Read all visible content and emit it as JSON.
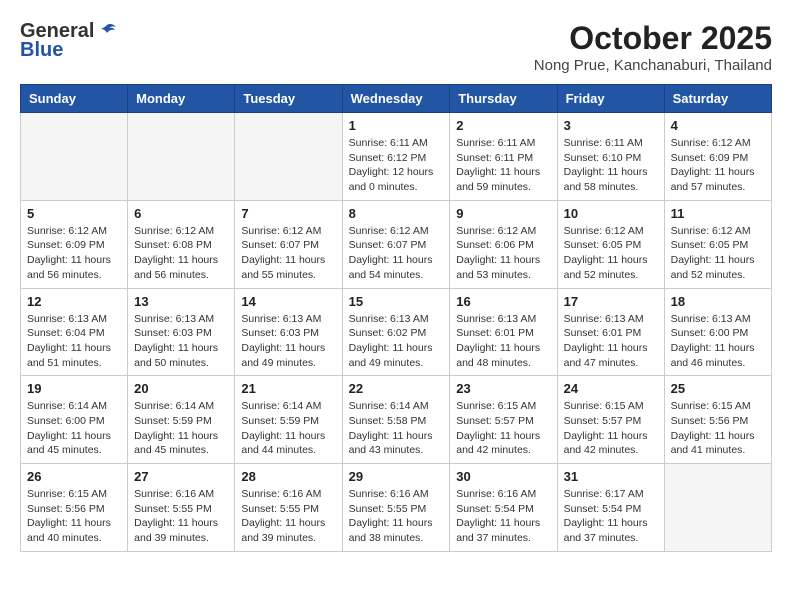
{
  "header": {
    "logo_general": "General",
    "logo_blue": "Blue",
    "month_title": "October 2025",
    "location": "Nong Prue, Kanchanaburi, Thailand"
  },
  "weekdays": [
    "Sunday",
    "Monday",
    "Tuesday",
    "Wednesday",
    "Thursday",
    "Friday",
    "Saturday"
  ],
  "weeks": [
    [
      {
        "day": "",
        "info": ""
      },
      {
        "day": "",
        "info": ""
      },
      {
        "day": "",
        "info": ""
      },
      {
        "day": "1",
        "info": "Sunrise: 6:11 AM\nSunset: 6:12 PM\nDaylight: 12 hours\nand 0 minutes."
      },
      {
        "day": "2",
        "info": "Sunrise: 6:11 AM\nSunset: 6:11 PM\nDaylight: 11 hours\nand 59 minutes."
      },
      {
        "day": "3",
        "info": "Sunrise: 6:11 AM\nSunset: 6:10 PM\nDaylight: 11 hours\nand 58 minutes."
      },
      {
        "day": "4",
        "info": "Sunrise: 6:12 AM\nSunset: 6:09 PM\nDaylight: 11 hours\nand 57 minutes."
      }
    ],
    [
      {
        "day": "5",
        "info": "Sunrise: 6:12 AM\nSunset: 6:09 PM\nDaylight: 11 hours\nand 56 minutes."
      },
      {
        "day": "6",
        "info": "Sunrise: 6:12 AM\nSunset: 6:08 PM\nDaylight: 11 hours\nand 56 minutes."
      },
      {
        "day": "7",
        "info": "Sunrise: 6:12 AM\nSunset: 6:07 PM\nDaylight: 11 hours\nand 55 minutes."
      },
      {
        "day": "8",
        "info": "Sunrise: 6:12 AM\nSunset: 6:07 PM\nDaylight: 11 hours\nand 54 minutes."
      },
      {
        "day": "9",
        "info": "Sunrise: 6:12 AM\nSunset: 6:06 PM\nDaylight: 11 hours\nand 53 minutes."
      },
      {
        "day": "10",
        "info": "Sunrise: 6:12 AM\nSunset: 6:05 PM\nDaylight: 11 hours\nand 52 minutes."
      },
      {
        "day": "11",
        "info": "Sunrise: 6:12 AM\nSunset: 6:05 PM\nDaylight: 11 hours\nand 52 minutes."
      }
    ],
    [
      {
        "day": "12",
        "info": "Sunrise: 6:13 AM\nSunset: 6:04 PM\nDaylight: 11 hours\nand 51 minutes."
      },
      {
        "day": "13",
        "info": "Sunrise: 6:13 AM\nSunset: 6:03 PM\nDaylight: 11 hours\nand 50 minutes."
      },
      {
        "day": "14",
        "info": "Sunrise: 6:13 AM\nSunset: 6:03 PM\nDaylight: 11 hours\nand 49 minutes."
      },
      {
        "day": "15",
        "info": "Sunrise: 6:13 AM\nSunset: 6:02 PM\nDaylight: 11 hours\nand 49 minutes."
      },
      {
        "day": "16",
        "info": "Sunrise: 6:13 AM\nSunset: 6:01 PM\nDaylight: 11 hours\nand 48 minutes."
      },
      {
        "day": "17",
        "info": "Sunrise: 6:13 AM\nSunset: 6:01 PM\nDaylight: 11 hours\nand 47 minutes."
      },
      {
        "day": "18",
        "info": "Sunrise: 6:13 AM\nSunset: 6:00 PM\nDaylight: 11 hours\nand 46 minutes."
      }
    ],
    [
      {
        "day": "19",
        "info": "Sunrise: 6:14 AM\nSunset: 6:00 PM\nDaylight: 11 hours\nand 45 minutes."
      },
      {
        "day": "20",
        "info": "Sunrise: 6:14 AM\nSunset: 5:59 PM\nDaylight: 11 hours\nand 45 minutes."
      },
      {
        "day": "21",
        "info": "Sunrise: 6:14 AM\nSunset: 5:59 PM\nDaylight: 11 hours\nand 44 minutes."
      },
      {
        "day": "22",
        "info": "Sunrise: 6:14 AM\nSunset: 5:58 PM\nDaylight: 11 hours\nand 43 minutes."
      },
      {
        "day": "23",
        "info": "Sunrise: 6:15 AM\nSunset: 5:57 PM\nDaylight: 11 hours\nand 42 minutes."
      },
      {
        "day": "24",
        "info": "Sunrise: 6:15 AM\nSunset: 5:57 PM\nDaylight: 11 hours\nand 42 minutes."
      },
      {
        "day": "25",
        "info": "Sunrise: 6:15 AM\nSunset: 5:56 PM\nDaylight: 11 hours\nand 41 minutes."
      }
    ],
    [
      {
        "day": "26",
        "info": "Sunrise: 6:15 AM\nSunset: 5:56 PM\nDaylight: 11 hours\nand 40 minutes."
      },
      {
        "day": "27",
        "info": "Sunrise: 6:16 AM\nSunset: 5:55 PM\nDaylight: 11 hours\nand 39 minutes."
      },
      {
        "day": "28",
        "info": "Sunrise: 6:16 AM\nSunset: 5:55 PM\nDaylight: 11 hours\nand 39 minutes."
      },
      {
        "day": "29",
        "info": "Sunrise: 6:16 AM\nSunset: 5:55 PM\nDaylight: 11 hours\nand 38 minutes."
      },
      {
        "day": "30",
        "info": "Sunrise: 6:16 AM\nSunset: 5:54 PM\nDaylight: 11 hours\nand 37 minutes."
      },
      {
        "day": "31",
        "info": "Sunrise: 6:17 AM\nSunset: 5:54 PM\nDaylight: 11 hours\nand 37 minutes."
      },
      {
        "day": "",
        "info": ""
      }
    ]
  ]
}
